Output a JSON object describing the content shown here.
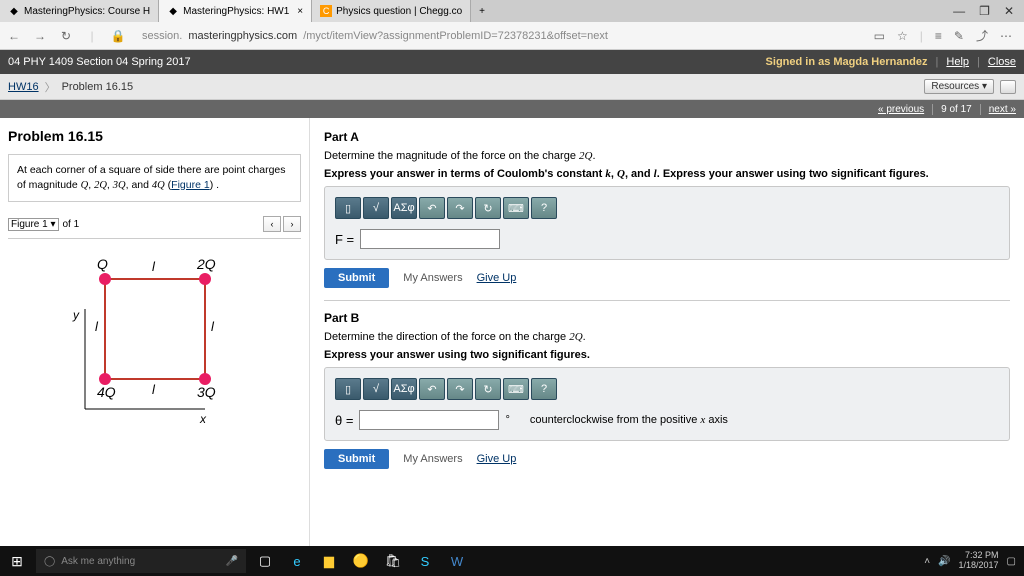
{
  "browser": {
    "tabs": [
      {
        "title": "MasteringPhysics: Course H"
      },
      {
        "title": "MasteringPhysics: HW1"
      },
      {
        "title": "Physics question | Chegg.co"
      }
    ],
    "url_prefix": "session.",
    "url_host": "masteringphysics.com",
    "url_path": "/myct/itemView?assignmentProblemID=72378231&offset=next"
  },
  "header": {
    "course": "04 PHY 1409 Section 04 Spring 2017",
    "signed_in": "Signed in as Magda Hernandez",
    "help": "Help",
    "close": "Close"
  },
  "breadcrumb": {
    "hw": "HW16",
    "problem": "Problem 16.15",
    "resources": "Resources"
  },
  "pagenav": {
    "prev": "« previous",
    "pos": "9 of 17",
    "next": "next »"
  },
  "problem": {
    "title": "Problem 16.15",
    "statement_a": "At each corner of a square of side there are point charges of magnitude ",
    "statement_b": ", and ",
    "statement_c": " (",
    "fig_link": "Figure 1",
    "statement_d": ") .",
    "q1": "Q",
    "q2": "2Q",
    "q3": "3Q",
    "q4": "4Q",
    "figure_select": "Figure 1",
    "figure_of": "of 1"
  },
  "partA": {
    "title": "Part A",
    "prompt": "Determine the magnitude of the force on the charge ",
    "target": "2Q",
    "instruct": "Express your answer in terms of Coulomb's constant ",
    "k": "k",
    "c1": ", ",
    "Q": "Q",
    "c2": ", and ",
    "l": "l",
    "instruct2": ". Express your answer using two significant figures.",
    "lhs": "F =",
    "submit": "Submit",
    "myans": "My Answers",
    "giveup": "Give Up",
    "greek": "ΑΣφ"
  },
  "partB": {
    "title": "Part B",
    "prompt": "Determine the direction of the force on the charge ",
    "target": "2Q",
    "instruct": "Express your answer using two significant figures.",
    "lhs": "θ =",
    "deg": "°",
    "hint": "counterclockwise from the positive ",
    "xaxis": "x",
    "hint2": " axis",
    "submit": "Submit",
    "myans": "My Answers",
    "giveup": "Give Up",
    "greek": "ΑΣφ"
  },
  "taskbar": {
    "cortana": "Ask me anything",
    "time": "7:32 PM",
    "date": "1/18/2017"
  },
  "chart_data": {
    "type": "diagram",
    "description": "Square of side l with point charges at corners",
    "corners": [
      {
        "pos": "top-left",
        "label": "Q"
      },
      {
        "pos": "top-right",
        "label": "2Q"
      },
      {
        "pos": "bottom-right",
        "label": "3Q"
      },
      {
        "pos": "bottom-left",
        "label": "4Q"
      }
    ],
    "side_label": "l",
    "axes": [
      "x",
      "y"
    ]
  }
}
